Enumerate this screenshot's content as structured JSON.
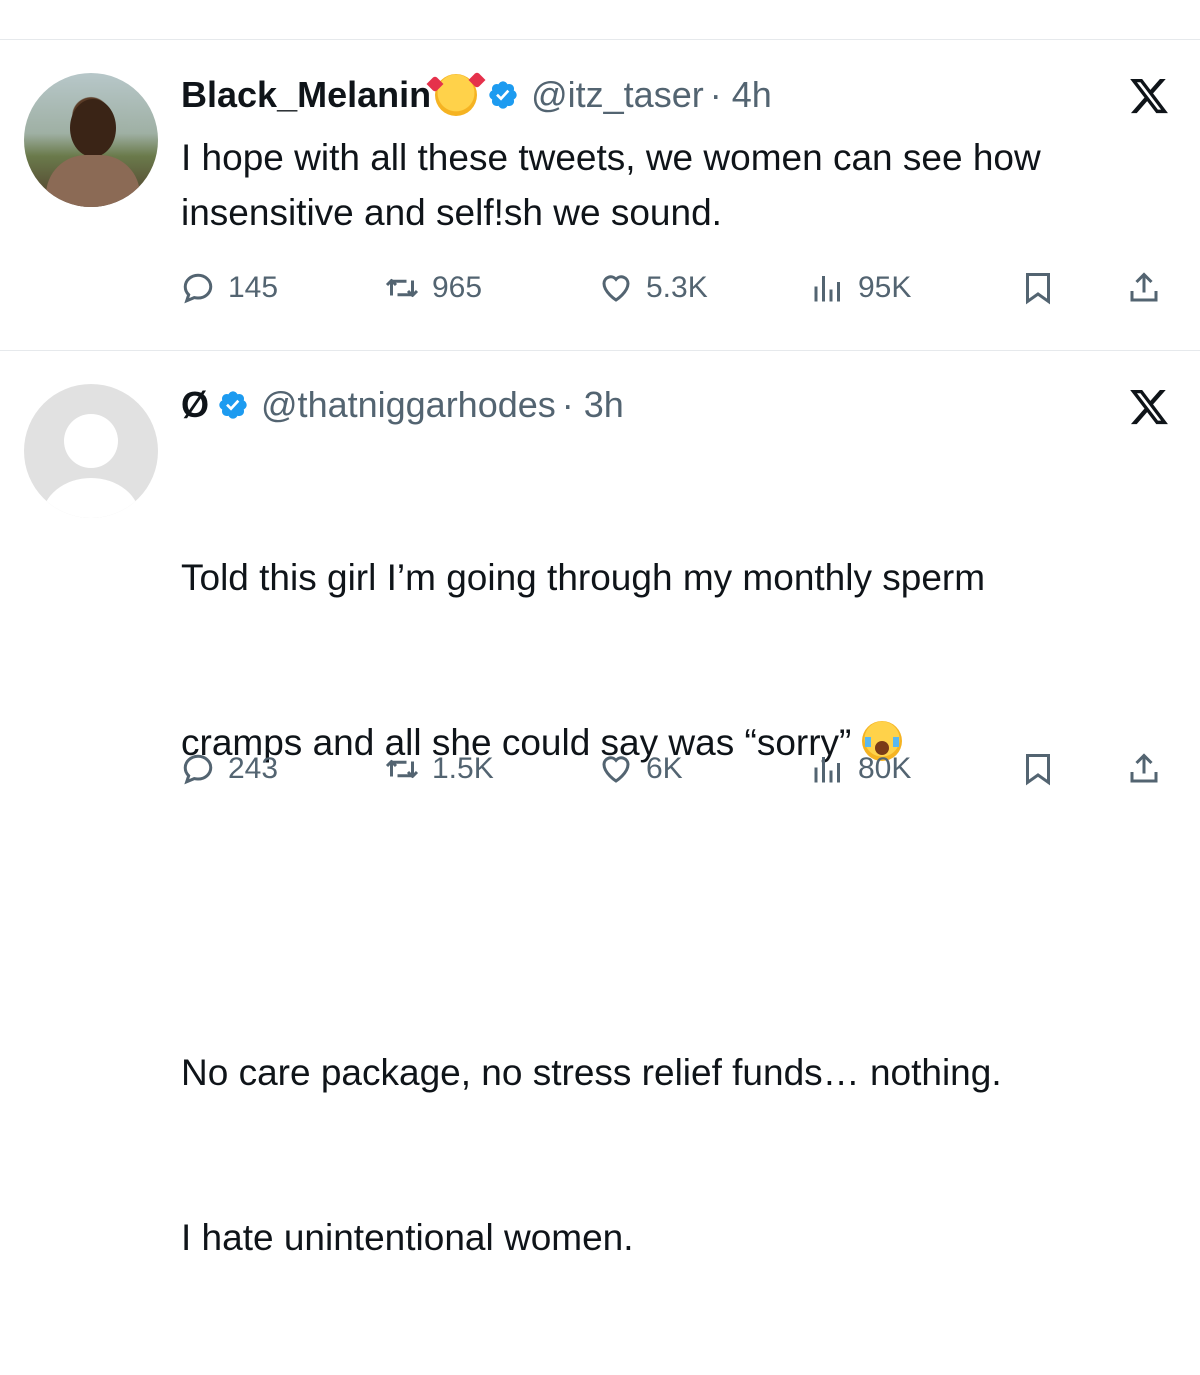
{
  "tweets": [
    {
      "name": "Black_Melanin",
      "handle": "@itz_taser",
      "time": "· 4h",
      "text": "I hope with all these tweets, we women can see how insensitive and self!sh we sound.",
      "stats": {
        "replies": "145",
        "reposts": "965",
        "likes": "5.3K",
        "views": "95K"
      },
      "avatar": "photo"
    },
    {
      "name": "Ø",
      "handle": "@thatniggarhodes",
      "time": "· 3h",
      "text_line1": "Told this girl I’m going through my monthly sperm",
      "text_line2": "cramps and all she could say was “sorry” ",
      "text_line3": "No care package, no stress relief funds… nothing.",
      "text_line4": "I hate unintentional women.",
      "stats": {
        "replies": "243",
        "reposts": "1.5K",
        "likes": "6K",
        "views": "80K"
      },
      "avatar": "default"
    }
  ],
  "icons": {
    "verified": "verified-badge-icon",
    "x_logo": "x-logo-icon",
    "reply": "reply-icon",
    "repost": "repost-icon",
    "like": "heart-icon",
    "views": "views-icon",
    "bookmark": "bookmark-icon",
    "share": "share-icon"
  },
  "colors": {
    "verified_blue": "#1d9bf0",
    "muted": "#536471",
    "text": "#0f1419"
  }
}
